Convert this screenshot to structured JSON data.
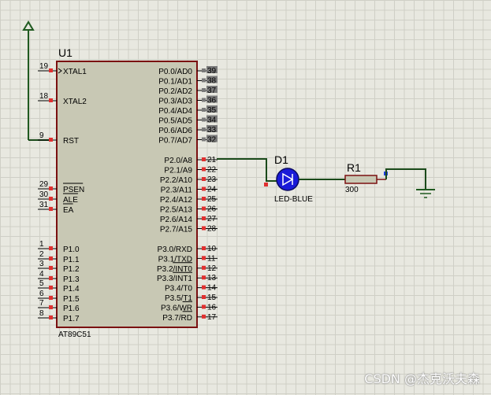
{
  "chip": {
    "ref": "U1",
    "part": "AT89C51",
    "left_pins": [
      {
        "num": "19",
        "name": "XTAL1"
      },
      {
        "num": "18",
        "name": "XTAL2"
      },
      {
        "num": "9",
        "name": "RST"
      },
      {
        "num": "29",
        "name": "PSEN"
      },
      {
        "num": "30",
        "name": "ALE"
      },
      {
        "num": "31",
        "name": "EA"
      },
      {
        "num": "1",
        "name": "P1.0"
      },
      {
        "num": "2",
        "name": "P1.1"
      },
      {
        "num": "3",
        "name": "P1.2"
      },
      {
        "num": "4",
        "name": "P1.3"
      },
      {
        "num": "5",
        "name": "P1.4"
      },
      {
        "num": "6",
        "name": "P1.5"
      },
      {
        "num": "7",
        "name": "P1.6"
      },
      {
        "num": "8",
        "name": "P1.7"
      }
    ],
    "right_pins": [
      {
        "num": "39",
        "name": "P0.0/AD0"
      },
      {
        "num": "38",
        "name": "P0.1/AD1"
      },
      {
        "num": "37",
        "name": "P0.2/AD2"
      },
      {
        "num": "36",
        "name": "P0.3/AD3"
      },
      {
        "num": "35",
        "name": "P0.4/AD4"
      },
      {
        "num": "34",
        "name": "P0.5/AD5"
      },
      {
        "num": "33",
        "name": "P0.6/AD6"
      },
      {
        "num": "32",
        "name": "P0.7/AD7"
      },
      {
        "num": "21",
        "name": "P2.0/A8"
      },
      {
        "num": "22",
        "name": "P2.1/A9"
      },
      {
        "num": "23",
        "name": "P2.2/A10"
      },
      {
        "num": "24",
        "name": "P2.3/A11"
      },
      {
        "num": "25",
        "name": "P2.4/A12"
      },
      {
        "num": "26",
        "name": "P2.5/A13"
      },
      {
        "num": "27",
        "name": "P2.6/A14"
      },
      {
        "num": "28",
        "name": "P2.7/A15"
      },
      {
        "num": "10",
        "name": "P3.0/RXD"
      },
      {
        "num": "11",
        "name": "P3.1/TXD"
      },
      {
        "num": "12",
        "name": "P3.2/INT0"
      },
      {
        "num": "13",
        "name": "P3.3/INT1"
      },
      {
        "num": "14",
        "name": "P3.4/T0"
      },
      {
        "num": "15",
        "name": "P3.5/T1"
      },
      {
        "num": "16",
        "name": "P3.6/WR"
      },
      {
        "num": "17",
        "name": "P3.7/RD"
      }
    ]
  },
  "led": {
    "ref": "D1",
    "value": "LED-BLUE"
  },
  "resistor": {
    "ref": "R1",
    "value": "300"
  },
  "watermark": "CSDN @杰克沃夫森",
  "colors": {
    "chip_fill": "#c8c8b4",
    "chip_border": "#7a1010",
    "wire": "#1a4a1a",
    "pin_square": "#e03030",
    "led_fill": "#1a1ad8",
    "resistor_fill": "#c8c8b4",
    "terminal": "#205a20"
  },
  "icons": [
    "power-arrow-icon",
    "ground-icon",
    "led-diode-icon",
    "resistor-icon"
  ]
}
